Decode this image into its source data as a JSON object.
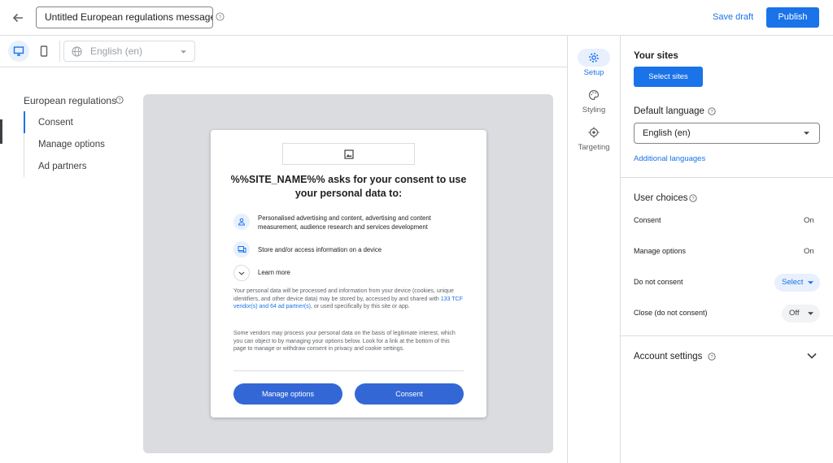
{
  "header": {
    "title_value": "Untitled European regulations message",
    "save_draft_label": "Save draft",
    "publish_label": "Publish"
  },
  "toolbar": {
    "language_value": "English (en)",
    "view_mode": "desktop"
  },
  "nav": {
    "title": "European regulations",
    "items": [
      {
        "label": "Consent",
        "active": true
      },
      {
        "label": "Manage options",
        "active": false
      },
      {
        "label": "Ad partners",
        "active": false
      }
    ]
  },
  "dialog": {
    "title": "%%SITE_NAME%% asks for your consent to use your personal data to:",
    "purposes": [
      "Personalised advertising and content, advertising and content measurement, audience research and services development",
      "Store and/or access information on a device"
    ],
    "learn_more": "Learn more",
    "body1_a": "Your personal data will be processed and information from your device (cookies, unique identifiers, and other device data) may be stored by, accessed by and shared with ",
    "body1_link": "133 TCF vendor(s) and 64 ad partner(s)",
    "body1_b": ", or used specifically by this site or app.",
    "body2": "Some vendors may process your personal data on the basis of legitimate interest, which you can object to by managing your options below. Look for a link at the bottom of this page to manage or withdraw consent in privacy and cookie settings.",
    "manage_label": "Manage options",
    "consent_label": "Consent"
  },
  "tabs": [
    {
      "label": "Setup",
      "icon": "gear-icon",
      "active": true
    },
    {
      "label": "Styling",
      "icon": "palette-icon",
      "active": false
    },
    {
      "label": "Targeting",
      "icon": "target-icon",
      "active": false
    }
  ],
  "panel": {
    "sites_title": "Your sites",
    "select_sites_label": "Select sites",
    "default_language_title": "Default language",
    "default_language_value": "English (en)",
    "additional_languages": "Additional languages",
    "user_choices_title": "User choices",
    "choices": [
      {
        "label": "Consent",
        "value": "On"
      },
      {
        "label": "Manage options",
        "value": "On"
      },
      {
        "label": "Do not consent",
        "value": "Select"
      },
      {
        "label": "Close (do not consent)",
        "value": "Off"
      }
    ],
    "account_settings_title": "Account settings"
  },
  "colors": {
    "accent": "#1a73e8",
    "dialog_button": "#3367d6",
    "preview_bg": "#dadce0"
  }
}
